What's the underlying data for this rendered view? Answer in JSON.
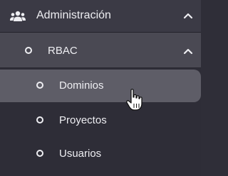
{
  "sidebar": {
    "group": {
      "label": "Administración",
      "icon": "users-icon",
      "expanded": true
    },
    "subgroup": {
      "label": "RBAC",
      "icon": "circle-icon",
      "expanded": true
    },
    "items": [
      {
        "label": "Dominios",
        "active": true
      },
      {
        "label": "Proyectos",
        "active": false
      },
      {
        "label": "Usuarios",
        "active": false
      }
    ]
  },
  "colors": {
    "background": "#2e2d37",
    "group_bg": "#3b3a45",
    "subgroup_bg": "#4a4953",
    "active_bg": "#5e5d67",
    "text": "#eeeef2"
  }
}
